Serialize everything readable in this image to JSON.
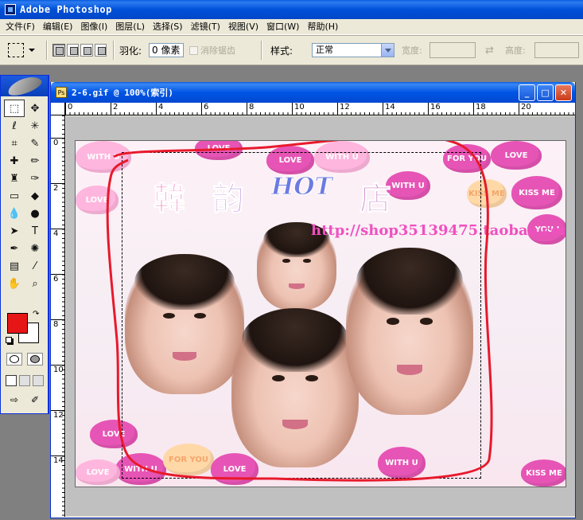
{
  "app": {
    "title": "Adobe Photoshop"
  },
  "menu": [
    "文件(F)",
    "编辑(E)",
    "图像(I)",
    "图层(L)",
    "选择(S)",
    "滤镜(T)",
    "视图(V)",
    "窗口(W)",
    "帮助(H)"
  ],
  "options": {
    "feather_label": "羽化:",
    "feather_value": "0 像素",
    "antialias_label": "消除锯齿",
    "style_label": "样式:",
    "style_value": "正常",
    "width_label": "宽度:",
    "height_label": "高度:"
  },
  "colors": {
    "foreground": "#e61616",
    "background": "#ffffff",
    "titlebar": "#0050d8"
  },
  "document": {
    "title": "2-6.gif @ 100%(索引)",
    "ruler_top": [
      "0",
      "2",
      "4",
      "6",
      "8",
      "10",
      "12",
      "14",
      "16",
      "18",
      "20"
    ],
    "ruler_left": [
      "0",
      "2",
      "4",
      "6",
      "8",
      "10",
      "12",
      "14"
    ]
  },
  "image": {
    "title_chars": [
      "韓",
      "韵",
      "HOT",
      "店"
    ],
    "url": "http://shop35139475.taobao.com",
    "hearts": [
      "WITH U",
      "LOVE",
      "WITH U",
      "LOVE",
      "FOR YOU",
      "LOVE",
      "KISS ME",
      "WITH U",
      "KISS ME",
      "LOVE",
      "YOU I",
      "LOVE",
      "WITH U",
      "FOR YOU",
      "LOVE",
      "WITH U",
      "LOVE",
      "KISS ME"
    ]
  }
}
